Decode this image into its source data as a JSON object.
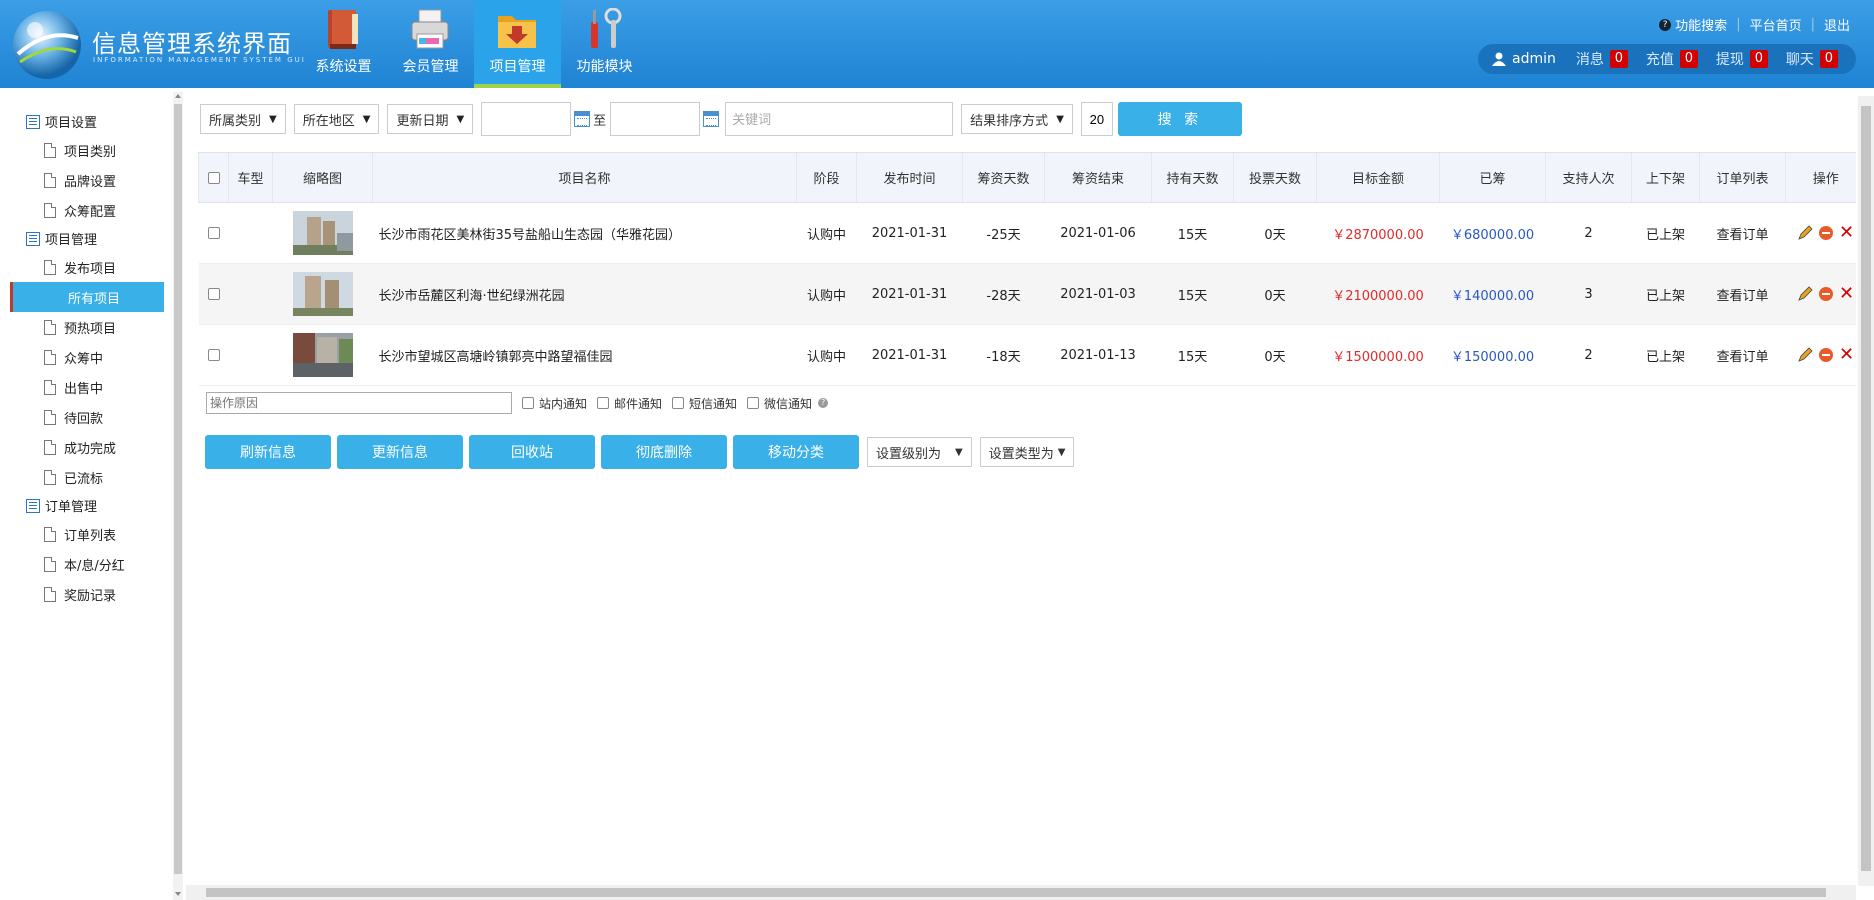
{
  "app": {
    "title": "信息管理系统界面",
    "subtitle": "INFORMATION MANAGEMENT SYSTEM GUI"
  },
  "nav": [
    {
      "label": "系统设置",
      "icon": "book-icon"
    },
    {
      "label": "会员管理",
      "icon": "printer-icon"
    },
    {
      "label": "项目管理",
      "icon": "folder-icon",
      "active": true
    },
    {
      "label": "功能模块",
      "icon": "tools-icon"
    }
  ],
  "top_links": {
    "search": "功能搜索",
    "home": "平台首页",
    "logout": "退出"
  },
  "user": {
    "name": "admin",
    "messages_label": "消息",
    "messages": "0",
    "recharge_label": "充值",
    "recharge": "0",
    "withdraw_label": "提现",
    "withdraw": "0",
    "chat_label": "聊天",
    "chat": "0"
  },
  "sidebar": {
    "groups": [
      {
        "label": "项目设置",
        "items": [
          "项目类别",
          "品牌设置",
          "众筹配置"
        ]
      },
      {
        "label": "项目管理",
        "items": [
          "发布项目",
          "所有项目",
          "预热项目",
          "众筹中",
          "出售中",
          "待回款",
          "成功完成",
          "已流标"
        ]
      },
      {
        "label": "订单管理",
        "items": [
          "订单列表",
          "本/息/分红",
          "奖励记录"
        ]
      }
    ],
    "active_item": "所有项目"
  },
  "filters": {
    "category": "所属类别",
    "region": "所在地区",
    "date": "更新日期",
    "to": "至",
    "keyword_placeholder": "关键词",
    "sort": "结果排序方式",
    "page_size": "20",
    "search": "搜 索"
  },
  "table": {
    "headers": [
      "车型",
      "缩略图",
      "项目名称",
      "阶段",
      "发布时间",
      "筹资天数",
      "筹资结束",
      "持有天数",
      "投票天数",
      "目标金额",
      "已筹",
      "支持人次",
      "上下架",
      "订单列表",
      "操作"
    ],
    "rows": [
      {
        "name": "长沙市雨花区美林街35号盐船山生态园（华雅花园）",
        "stage": "认购中",
        "publish": "2021-01-31",
        "days": "-25天",
        "end": "2021-01-06",
        "hold": "15天",
        "vote": "0天",
        "target": "￥2870000.00",
        "raised": "￥680000.00",
        "supporters": "2",
        "shelf": "已上架",
        "orders": "查看订单"
      },
      {
        "name": "长沙市岳麓区利海·世纪绿洲花园",
        "stage": "认购中",
        "publish": "2021-01-31",
        "days": "-28天",
        "end": "2021-01-03",
        "hold": "15天",
        "vote": "0天",
        "target": "￥2100000.00",
        "raised": "￥140000.00",
        "supporters": "3",
        "shelf": "已上架",
        "orders": "查看订单"
      },
      {
        "name": "长沙市望城区高塘岭镇郭亮中路望福佳园",
        "stage": "认购中",
        "publish": "2021-01-31",
        "days": "-18天",
        "end": "2021-01-13",
        "hold": "15天",
        "vote": "0天",
        "target": "￥1500000.00",
        "raised": "￥150000.00",
        "supporters": "2",
        "shelf": "已上架",
        "orders": "查看订单"
      }
    ]
  },
  "bulk": {
    "reason_placeholder": "操作原因",
    "notify": [
      "站内通知",
      "邮件通知",
      "短信通知",
      "微信通知"
    ],
    "buttons": [
      "刷新信息",
      "更新信息",
      "回收站",
      "彻底删除",
      "移动分类"
    ],
    "level_select": "设置级别为",
    "type_select": "设置类型为"
  },
  "colors": {
    "header": "#2a90dc",
    "accent": "#3ab0e8",
    "amount_red": "#e12b2b",
    "amount_blue": "#2a56c6",
    "badge": "#d40000"
  }
}
